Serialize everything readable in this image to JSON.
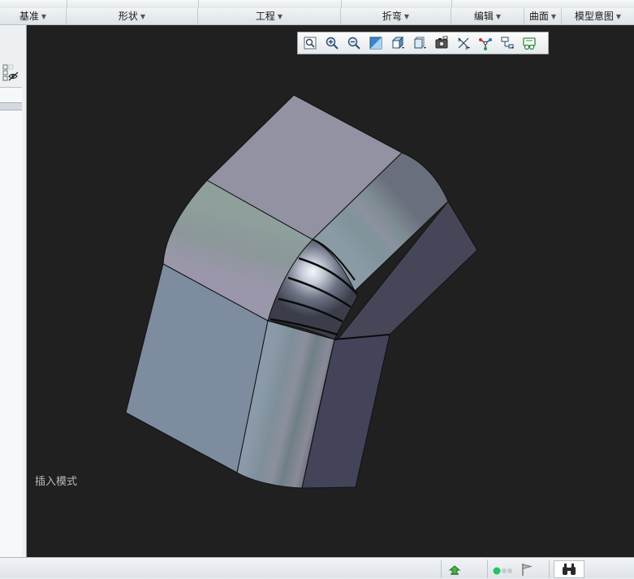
{
  "ribbon": {
    "groups": [
      {
        "label": "基准",
        "caret": "▼"
      },
      {
        "label": "形状",
        "caret": "▼"
      },
      {
        "label": "工程",
        "caret": "▼"
      },
      {
        "label": "折弯",
        "caret": "▼"
      },
      {
        "label": "编辑",
        "caret": "▼"
      },
      {
        "label": "曲面",
        "caret": "▼"
      },
      {
        "label": "模型意图",
        "caret": "▼"
      }
    ]
  },
  "view_toolbar": {
    "buttons": [
      {
        "icon": "refit-icon"
      },
      {
        "icon": "zoom-in-icon"
      },
      {
        "icon": "zoom-out-icon"
      },
      {
        "icon": "repaint-icon"
      },
      {
        "icon": "display-style-icon"
      },
      {
        "icon": "saved-views-icon"
      },
      {
        "icon": "view-manager-icon"
      },
      {
        "icon": "datum-display-icon"
      },
      {
        "icon": "spin-center-icon"
      },
      {
        "icon": "annotation-display-icon"
      },
      {
        "icon": "view-normal-icon"
      }
    ]
  },
  "viewport": {
    "background": "#202020",
    "mode_text": "插入模式"
  },
  "status_bar": {
    "status_color": "#22c55e"
  }
}
